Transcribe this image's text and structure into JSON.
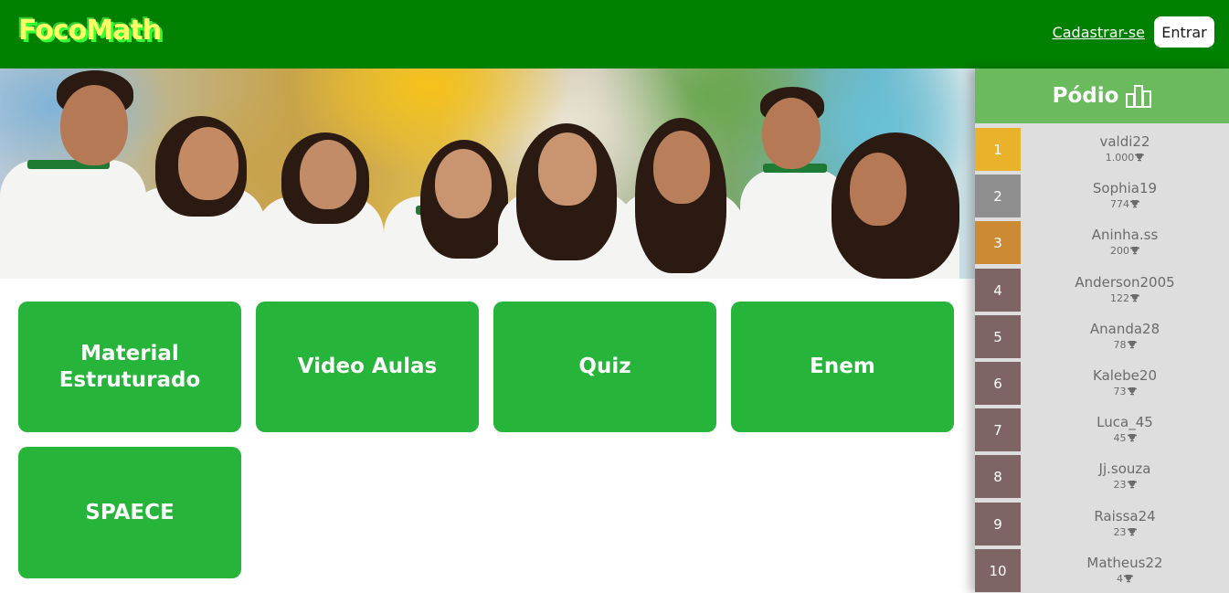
{
  "header": {
    "logo": "FocoMath",
    "signup_label": "Cadastrar-se",
    "login_label": "Entrar"
  },
  "tiles": [
    {
      "label": "Material Estruturado"
    },
    {
      "label": "Video Aulas"
    },
    {
      "label": "Quiz"
    },
    {
      "label": "Enem"
    },
    {
      "label": "SPAECE"
    }
  ],
  "podium": {
    "title": "Pódio",
    "icon": "podium-icon",
    "trophy_icon": "trophy-icon",
    "entries": [
      {
        "rank": "1",
        "name": "valdi22",
        "score": "1.000",
        "color": "#e8b32b"
      },
      {
        "rank": "2",
        "name": "Sophia19",
        "score": "774",
        "color": "#8f8f8f"
      },
      {
        "rank": "3",
        "name": "Aninha.ss",
        "score": "200",
        "color": "#cd8a34"
      },
      {
        "rank": "4",
        "name": "Anderson2005",
        "score": "122",
        "color": "#7e6464"
      },
      {
        "rank": "5",
        "name": "Ananda28",
        "score": "78",
        "color": "#7e6464"
      },
      {
        "rank": "6",
        "name": "Kalebe20",
        "score": "73",
        "color": "#7e6464"
      },
      {
        "rank": "7",
        "name": "Luca_45",
        "score": "45",
        "color": "#7e6464"
      },
      {
        "rank": "8",
        "name": "Jj.souza",
        "score": "23",
        "color": "#7e6464"
      },
      {
        "rank": "9",
        "name": "Raissa24",
        "score": "23",
        "color": "#7e6464"
      },
      {
        "rank": "10",
        "name": "Matheus22",
        "score": "4",
        "color": "#7e6464"
      }
    ]
  },
  "colors": {
    "header_bg": "#008000",
    "tile_bg": "#26b43a",
    "podium_header_bg": "#6bbb5e",
    "podium_bg": "#dedede"
  }
}
